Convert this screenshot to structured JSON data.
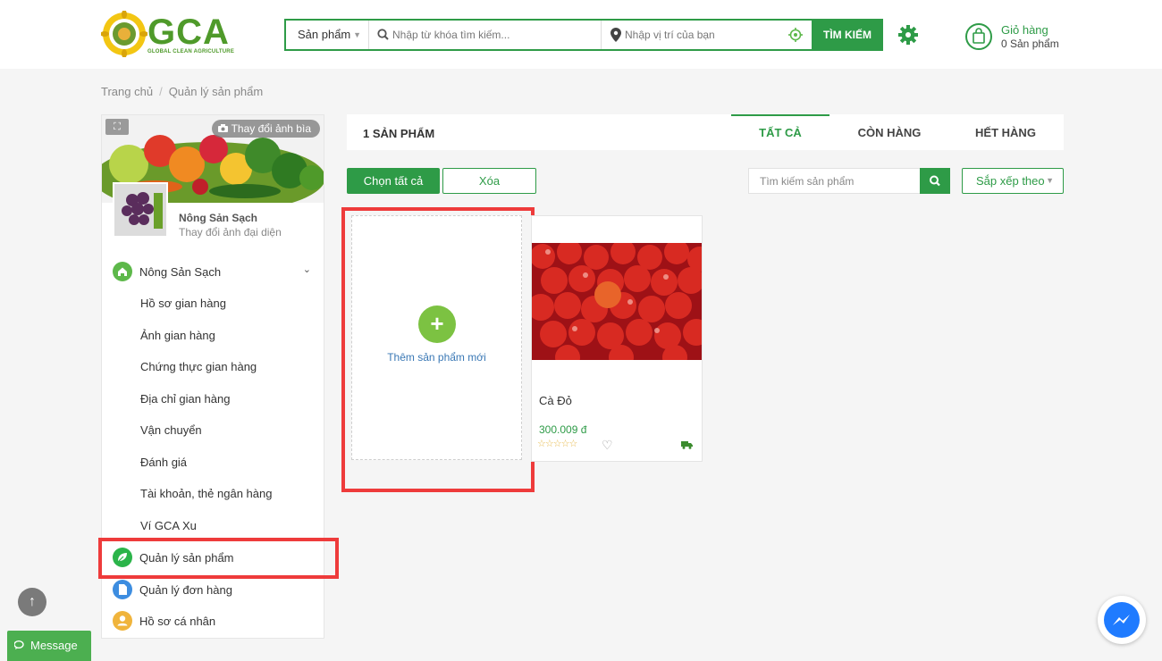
{
  "brand": {
    "logo_text": "GCA",
    "tagline": "GLOBAL CLEAN AGRICULTURE",
    "colors": {
      "primary": "#2e9b47",
      "accent_light": "#7cc242",
      "highlight": "#ee3b3b"
    }
  },
  "header": {
    "category_select": "Sản phẩm",
    "keyword_placeholder": "Nhập từ khóa tìm kiếm...",
    "location_placeholder": "Nhập vị trí của bạn",
    "search_button": "TÌM KIẾM",
    "cart_title": "Giỏ hàng",
    "cart_count": "0 Sản phẩm"
  },
  "breadcrumb": {
    "home": "Trang chủ",
    "current": "Quản lý sản phẩm"
  },
  "sidebar": {
    "change_cover": "Thay đổi ảnh bìa",
    "store_name": "Nông Sản Sạch",
    "change_avatar": "Thay đổi ảnh đại diện",
    "main_item": "Nông Sản Sạch",
    "sub_items": [
      "Hồ sơ gian hàng",
      "Ảnh gian hàng",
      "Chứng thực gian hàng",
      "Địa chỉ gian hàng",
      "Vận chuyển",
      "Đánh giá",
      "Tài khoản, thẻ ngân hàng",
      "Ví GCA Xu"
    ],
    "bottom_items": [
      {
        "label": "Quản lý sản phẩm",
        "icon": "leaf-icon",
        "color": "#2bb44a"
      },
      {
        "label": "Quản lý đơn hàng",
        "icon": "document-icon",
        "color": "#3d8de0"
      },
      {
        "label": "Hồ sơ cá nhân",
        "icon": "user-icon",
        "color": "#f0b43c"
      }
    ]
  },
  "main": {
    "product_count": "1 SẢN PHẨM",
    "tabs": [
      "TẤT CẢ",
      "CÒN HÀNG",
      "HẾT HÀNG"
    ],
    "active_tab": "TẤT CẢ",
    "select_all": "Chọn tất cả",
    "delete": "Xóa",
    "search_placeholder": "Tìm kiếm sản phẩm",
    "sort_label": "Sắp xếp theo",
    "add_product": "Thêm sản phẩm mới",
    "products": [
      {
        "name": "Cà Đỏ",
        "price": "300.009 đ",
        "rating": 0
      }
    ]
  },
  "floating": {
    "message": "Message"
  }
}
